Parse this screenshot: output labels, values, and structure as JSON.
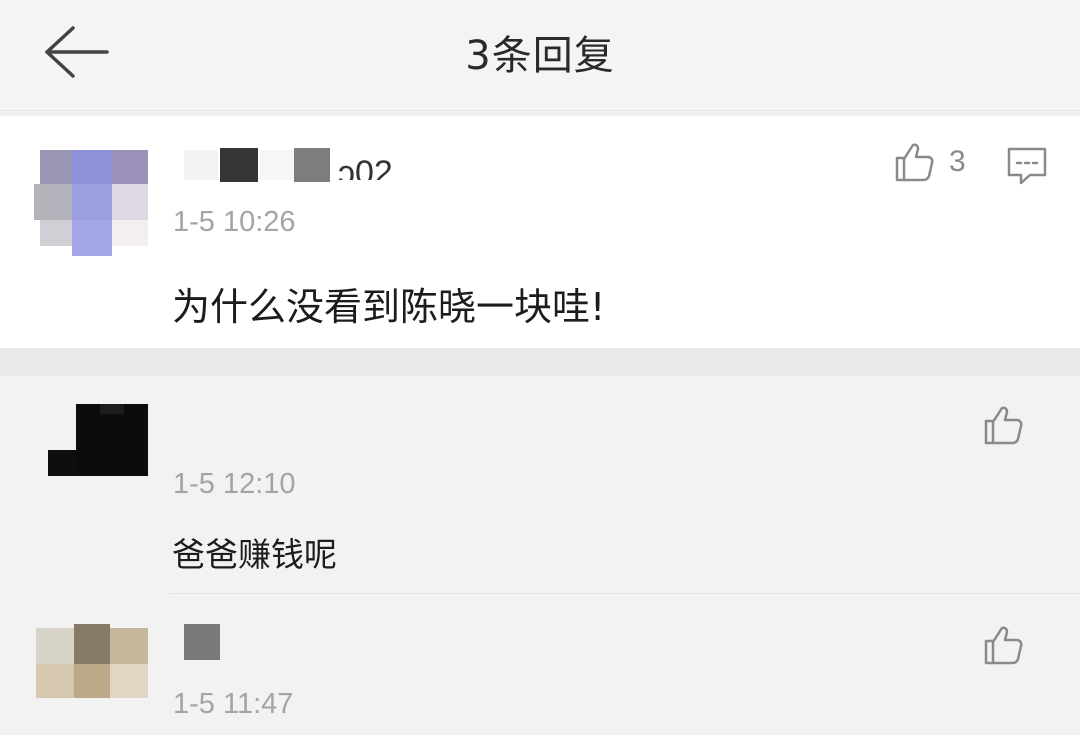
{
  "header": {
    "title": "3条回复",
    "back_icon": "arrow-left-icon"
  },
  "main_comment": {
    "username_visible_fragment": "ɔ02",
    "timestamp": "1-5 10:26",
    "text": "为什么没看到陈晓一块哇!",
    "like_count": "3",
    "like_icon": "thumbs-up-icon",
    "reply_icon": "comment-icon"
  },
  "replies": [
    {
      "timestamp": "1-5 12:10",
      "text": "爸爸赚钱呢",
      "like_icon": "thumbs-up-icon"
    },
    {
      "timestamp": "1-5 11:47",
      "like_icon": "thumbs-up-icon"
    }
  ],
  "colors": {
    "header_bg": "#f4f4f4",
    "main_bg": "#ffffff",
    "reply_bg": "#f2f2f2",
    "timestamp": "#a4a4a4",
    "icon": "#8a8a8a"
  }
}
